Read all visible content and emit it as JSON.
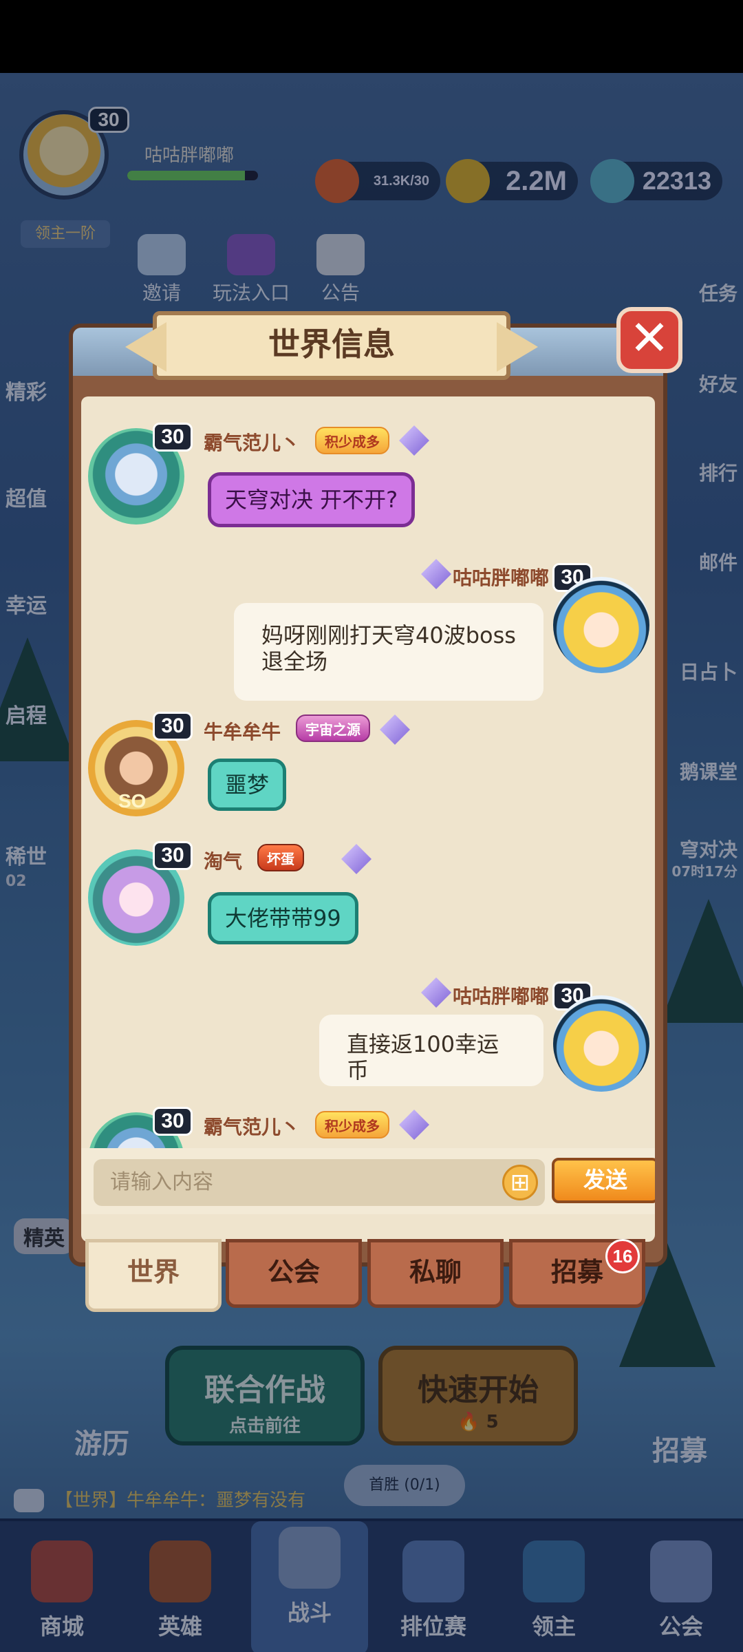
{
  "background": {
    "player": {
      "name": "咕咕胖嘟嘟",
      "level": "30",
      "rank": "领主一阶",
      "xp_fraction": 0.9
    },
    "resources": [
      {
        "icon": "stamina-flame-icon",
        "value": "31.3K/30"
      },
      {
        "icon": "gold-coin-icon",
        "value": "2.2M"
      },
      {
        "icon": "crystal-star-icon",
        "value": "22313"
      }
    ],
    "top_buttons": [
      "邀请",
      "玩法入口",
      "公告"
    ],
    "left_menu": [
      "精彩",
      "超值",
      "幸运",
      "启程",
      "稀世",
      "精英"
    ],
    "right_menu": [
      "任务",
      "好友",
      "排行",
      "邮件",
      "日占卜",
      "鹅课堂",
      "穹对决"
    ],
    "right_menu_timer": "07时17分",
    "left_menu_timer": "02",
    "coop_battle": {
      "title": "联合作战",
      "subtitle": "点击前往"
    },
    "quick_start": {
      "title": "快速开始",
      "cost": "5"
    },
    "travel_label": "游历",
    "recruit_label": "招募",
    "ticker": "【世界】牛牟牟牛：噩梦有没有",
    "first_win": "首胜 (0/1)",
    "bottom_nav": [
      "商城",
      "英雄",
      "战斗",
      "排位赛",
      "领主",
      "公会"
    ]
  },
  "dialog": {
    "title": "世界信息",
    "close_symbol": "✕",
    "messages": [
      {
        "side": "left",
        "avatar": "skull-dragon-avatar",
        "level": "30",
        "name": "霸气范儿丶",
        "badge": "积少成多",
        "badge_style": "gold",
        "text": "天穹对决 开不开?",
        "bubble": "vine-purple"
      },
      {
        "side": "right",
        "avatar": "blonde-girl-avatar",
        "level": "30",
        "name": "咕咕胖嘟嘟",
        "text_lines": [
          "妈呀刚刚打天穹40波boss",
          "退全场"
        ],
        "bubble": "plain"
      },
      {
        "side": "left",
        "avatar": "monkey-king-avatar",
        "level": "30",
        "name": "牛牟牟牛",
        "badge": "宇宙之源",
        "badge_style": "purple",
        "avatar_tag": "SO",
        "text": "噩梦",
        "bubble": "vine-teal"
      },
      {
        "side": "left",
        "avatar": "pink-hair-avatar",
        "level": "30",
        "name": "淘气",
        "badge": "坏蛋",
        "badge_style": "red",
        "text": "大佬带带99",
        "bubble": "vine-teal"
      },
      {
        "side": "right",
        "avatar": "blonde-girl-avatar",
        "level": "30",
        "name": "咕咕胖嘟嘟",
        "text": "直接返100幸运币",
        "bubble": "plain"
      },
      {
        "side": "left",
        "avatar": "skull-dragon-avatar",
        "level": "30",
        "name": "霸气范儿丶",
        "badge": "积少成多",
        "badge_style": "gold"
      }
    ],
    "input_placeholder": "请输入内容",
    "send_label": "发送",
    "tabs": [
      "世界",
      "公会",
      "私聊",
      "招募"
    ],
    "active_tab": "世界",
    "recruit_badge": "16"
  }
}
